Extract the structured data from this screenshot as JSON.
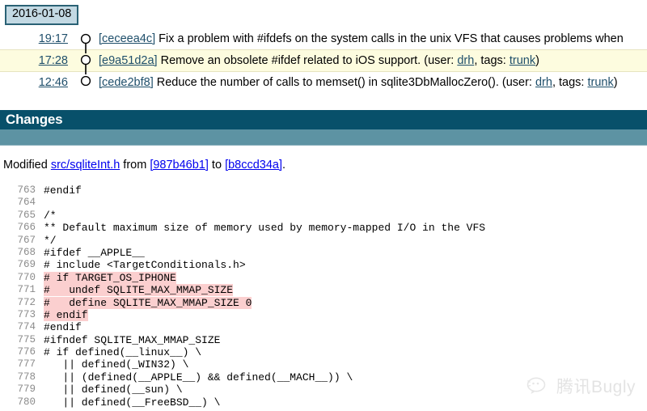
{
  "timeline": {
    "date_badge": "2016-01-08",
    "entries": [
      {
        "time": "19:17",
        "hash": "[ceceea4c]",
        "message": "Fix a problem with #ifdefs on the system calls in the unix VFS that causes problems when",
        "selected": false,
        "meta_prefix": "",
        "user_label": "",
        "user": "",
        "tags_label": "",
        "tags": "",
        "meta_suffix": ""
      },
      {
        "time": "17:28",
        "hash": "[e9a51d2a]",
        "message": "Remove an obsolete #ifdef related to iOS support.",
        "selected": true,
        "meta_prefix": " (user: ",
        "user": "drh",
        "tags_label": ", tags: ",
        "tags": "trunk",
        "meta_suffix": ")"
      },
      {
        "time": "12:46",
        "hash": "[cede2bf8]",
        "message": "Reduce the number of calls to memset() in sqlite3DbMallocZero().",
        "selected": false,
        "meta_prefix": " (user: ",
        "user": "drh",
        "tags_label": ", tags: ",
        "tags": "trunk",
        "meta_suffix": ")"
      }
    ]
  },
  "changes": {
    "header_title": "Changes",
    "modified": {
      "prefix": "Modified ",
      "file": "src/sqliteInt.h",
      "from_label": " from ",
      "from_hash": "[987b46b1]",
      "to_label": " to ",
      "to_hash": "[b8ccd34a]",
      "suffix": "."
    }
  },
  "code": {
    "lines": [
      {
        "n": "763",
        "plain": "#endif",
        "highlight": false
      },
      {
        "n": "764",
        "plain": "",
        "highlight": false
      },
      {
        "n": "765",
        "plain": "/*",
        "highlight": false
      },
      {
        "n": "766",
        "plain": "** Default maximum size of memory used by memory-mapped I/O in the VFS",
        "highlight": false
      },
      {
        "n": "767",
        "plain": "*/",
        "highlight": false
      },
      {
        "n": "768",
        "plain": "#ifdef __APPLE__",
        "highlight": false
      },
      {
        "n": "769",
        "plain": "# include <TargetConditionals.h>",
        "highlight": false
      },
      {
        "n": "770",
        "plain": "# if TARGET_OS_IPHONE",
        "highlight": true
      },
      {
        "n": "771",
        "plain": "#   undef SQLITE_MAX_MMAP_SIZE",
        "highlight": true
      },
      {
        "n": "772",
        "plain": "#   define SQLITE_MAX_MMAP_SIZE 0",
        "highlight": true
      },
      {
        "n": "773",
        "plain": "# endif",
        "highlight": true
      },
      {
        "n": "774",
        "plain": "#endif",
        "highlight": false
      },
      {
        "n": "775",
        "plain": "#ifndef SQLITE_MAX_MMAP_SIZE",
        "highlight": false
      },
      {
        "n": "776",
        "plain": "# if defined(__linux__) \\",
        "highlight": false
      },
      {
        "n": "777",
        "plain": "   || defined(_WIN32) \\",
        "highlight": false
      },
      {
        "n": "778",
        "plain": "   || (defined(__APPLE__) && defined(__MACH__)) \\",
        "highlight": false
      },
      {
        "n": "779",
        "plain": "   || defined(__sun) \\",
        "highlight": false
      },
      {
        "n": "780",
        "plain": "   || defined(__FreeBSD__) \\",
        "highlight": false
      }
    ]
  },
  "watermark": {
    "text": "腾讯Bugly",
    "icon": "wechat-bubble-icon"
  },
  "colors": {
    "header_dark": "#08506a",
    "header_light": "#5d93a3",
    "badge_bg": "#c3d9e3",
    "badge_border": "#2a6275",
    "selected_row": "#fdfcdf",
    "diff_highlight": "#fbcfcf",
    "link": "#1f4f6b"
  }
}
